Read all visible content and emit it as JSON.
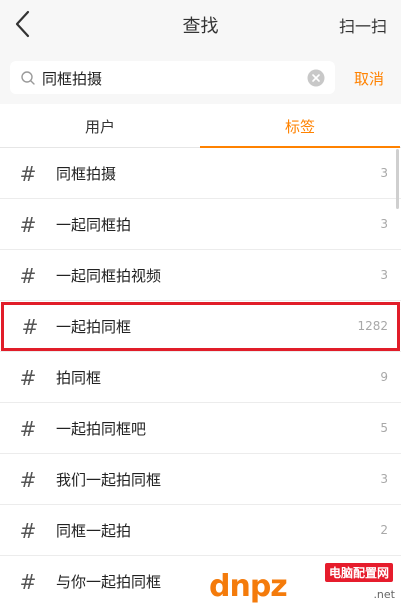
{
  "header": {
    "title": "查找",
    "scan_label": "扫一扫"
  },
  "search": {
    "value": "同框拍摄",
    "cancel_label": "取消"
  },
  "tabs": [
    {
      "label": "用户",
      "active": false
    },
    {
      "label": "标签",
      "active": true
    }
  ],
  "colors": {
    "accent": "#ff8200",
    "highlight_box": "#e11d29"
  },
  "tags": [
    {
      "label": "同框拍摄",
      "count": "3"
    },
    {
      "label": "一起同框拍",
      "count": "3"
    },
    {
      "label": "一起同框拍视频",
      "count": "3"
    },
    {
      "label": "一起拍同框",
      "count": "1282",
      "highlighted": true
    },
    {
      "label": "拍同框",
      "count": "9"
    },
    {
      "label": "一起拍同框吧",
      "count": "5"
    },
    {
      "label": "我们一起拍同框",
      "count": "3"
    },
    {
      "label": "同框一起拍",
      "count": "2"
    },
    {
      "label": "与你一起拍同框",
      "count": ""
    }
  ],
  "watermark": {
    "logo": "dnpz",
    "tag": "电脑配置网",
    "url": ".net"
  }
}
